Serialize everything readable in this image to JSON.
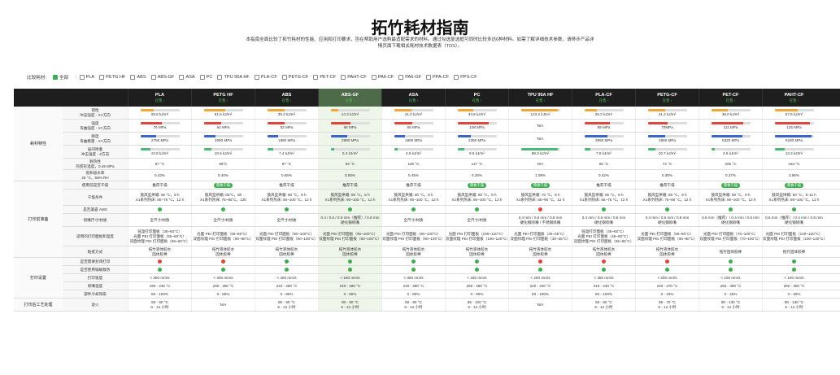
{
  "page": {
    "title": "拓竹耗材指南",
    "description": "本指南全面比较了拓竹耗材的性能、应用和打印要求，旨在帮助用户选购最适配需求的材料。通过勾选复选框可同时比较多达6种材料。如需了解详细技术参数，请移步产品详情页面下载相关耗材技术数据表（TDS）。"
  },
  "colors": {
    "accent": "#3fae4e",
    "header_bg": "#1e1e1e",
    "danger": "#e0463a",
    "highlight": "#eef6ea"
  },
  "filter": {
    "label": "比较耗材:",
    "options": [
      {
        "label": "全部",
        "checked": true
      },
      {
        "label": "PLA",
        "checked": false
      },
      {
        "label": "PETG HF",
        "checked": false
      },
      {
        "label": "ABS",
        "checked": false
      },
      {
        "label": "ABS-GF",
        "checked": false
      },
      {
        "label": "ASA",
        "checked": false
      },
      {
        "label": "PC",
        "checked": false
      },
      {
        "label": "TPU 95A HF",
        "checked": false
      },
      {
        "label": "PLA-CF",
        "checked": false
      },
      {
        "label": "PETG-CF",
        "checked": false
      },
      {
        "label": "PET-CF",
        "checked": false
      },
      {
        "label": "PAHT-CF",
        "checked": false
      },
      {
        "label": "PA6-CF",
        "checked": false
      },
      {
        "label": "PA6-GF",
        "checked": false
      },
      {
        "label": "PPA-CF",
        "checked": false
      },
      {
        "label": "PPS-CF",
        "checked": false
      }
    ]
  },
  "materials": [
    {
      "name": "PLA",
      "sub": "在售 ›"
    },
    {
      "name": "PETG HF",
      "sub": "在售 ›"
    },
    {
      "name": "ABS",
      "sub": "在售 ›"
    },
    {
      "name": "ABS-GF",
      "sub": "在售 ›"
    },
    {
      "name": "ASA",
      "sub": "在售 ›"
    },
    {
      "name": "PC",
      "sub": "在售 ›"
    },
    {
      "name": "TPU 95A HF",
      "sub": "在售 ›"
    },
    {
      "name": "PLA-CF",
      "sub": "在售 ›"
    },
    {
      "name": "PETG-CF",
      "sub": "在售 ›"
    },
    {
      "name": "PET-CF",
      "sub": "在售 ›"
    },
    {
      "name": "PAHT-CF",
      "sub": "在售 ›"
    }
  ],
  "groups": [
    {
      "label": "耗材特性",
      "rows": [
        {
          "attr": "韧性\n冲击强度 - XY方向",
          "h": 16,
          "type": "bar",
          "scheme": "orange",
          "values": [
            "28.6 kJ/m²",
            "51.5 kJ/m²",
            "39.3 kJ/m²",
            "14.3 kJ/m²",
            "41.0 kJ/m²",
            "34.8 kJ/m²",
            "123.2 kJ/m²",
            "25.2 kJ/m²",
            "41.2 kJ/m²",
            "36.0 kJ/m²",
            "57.5 kJ/m²"
          ],
          "levels": [
            0.35,
            0.55,
            0.45,
            0.2,
            0.45,
            0.4,
            0.95,
            0.32,
            0.45,
            0.42,
            0.6
          ]
        },
        {
          "attr": "强度\n弯曲强度 - XY方向",
          "h": 16,
          "type": "bar",
          "scheme": "red",
          "values": [
            "76 MPa",
            "64 MPa",
            "62 MPa",
            "68 MPa",
            "65 MPa",
            "108 MPa",
            "N/A",
            "89 MPa",
            "70MPa",
            "111 MPa",
            "125 MPa"
          ],
          "levels": [
            0.55,
            0.45,
            0.45,
            0.5,
            0.47,
            0.8,
            null,
            0.65,
            0.5,
            0.82,
            0.9
          ]
        },
        {
          "attr": "刚度\n弯曲模量 - XY方向",
          "h": 16,
          "type": "bar",
          "scheme": "blue",
          "values": [
            "2750 MPa",
            "2050 MPa",
            "1880 MPa",
            "2860 MPa",
            "1900 MPa",
            "2350 MPa",
            "N/A",
            "3950 MPa",
            "2950 MPa",
            "5320 MPa",
            "6230 MPa"
          ],
          "levels": [
            0.4,
            0.3,
            0.28,
            0.42,
            0.28,
            0.35,
            null,
            0.6,
            0.45,
            0.8,
            0.95
          ]
        },
        {
          "attr": "层间附着\n冲击强度 - Z方向",
          "h": 16,
          "type": "bar",
          "scheme": "green",
          "values": [
            "13.8 kJ/m²",
            "10.6 kJ/m²",
            "7.4 kJ/m²",
            "5.3 kJ/m²",
            "4.9 kJ/m²",
            "9.8 kJ/m²",
            "88.3 kJ/m²",
            "7.8 kJ/m²",
            "10.7 kJ/m²",
            "4.5 kJ/m²",
            "13.3 kJ/m²"
          ],
          "levels": [
            0.25,
            0.2,
            0.15,
            0.1,
            0.1,
            0.18,
            0.95,
            0.15,
            0.2,
            0.1,
            0.25
          ]
        },
        {
          "attr": "耐热性\n热变形温度，0.45 MPa",
          "h": 14,
          "type": "text",
          "values": [
            "57 °C",
            "69°C",
            "87 °C",
            "94 °C",
            "100 °C",
            "117 °C",
            "N/A",
            "55 °C",
            "74 °C",
            "205 °C",
            "194 °C"
          ]
        },
        {
          "attr": "饱和吸水率\n25 °C，55% RH",
          "h": 14,
          "type": "text",
          "values": [
            "0.43%",
            "0.40%",
            "0.65%",
            "0.55%",
            "0.45%",
            "0.25%",
            "1.08%",
            "0.42%",
            "0.30%",
            "0.37%",
            "3.86%"
          ]
        }
      ]
    },
    {
      "label": "打印前准备",
      "rows": [
        {
          "attr": "使用前是否干燥",
          "h": 10,
          "type": "mixed",
          "values": [
            {
              "t": "推荐干燥"
            },
            {
              "t": "需要干燥",
              "pill": true
            },
            {
              "t": "推荐干燥"
            },
            {
              "t": "推荐干燥"
            },
            {
              "t": "推荐干燥"
            },
            {
              "t": "需要干燥",
              "pill": true
            },
            {
              "t": "需要干燥",
              "pill": true
            },
            {
              "t": "推荐干燥"
            },
            {
              "t": "推荐干燥"
            },
            {
              "t": "需要干燥",
              "pill": true
            },
            {
              "t": "需要干燥",
              "pill": true
            }
          ]
        },
        {
          "attr": "干燥条件",
          "h": 20,
          "type": "text",
          "values": [
            "鼓风型烘箱: 55 °C，8 h\nX1系列热床: 65~75 °C，12 h",
            "鼓风型烘箱: 65°C，8h\nX1系列热床: 75~85°C，12h",
            "鼓风型烘箱: 80 °C，8 h\nX1系列热床: 90~100 °C，12 h",
            "鼓风型烘箱: 80 °C，8 h\nX1系列热床: 90~100 °C，12 h",
            "鼓风型烘箱: 80 °C，8 h\nX1系列热床: 90~100 °C，12 h",
            "鼓风型烘箱: 80 °C，8 h\nX1系列热床: 90~100 °C，12 h",
            "鼓风型烘箱: 70 °C，8 h\nX1系列热床: 80~90 °C，12 h",
            "鼓风型烘箱: 55 °C，8 h\nX1系列热床: 65~75 °C，12 h",
            "鼓风型烘箱: 65 °C，8 h\nX1系列热床: 75~85 °C，12 h",
            "鼓风型烘箱: 80 °C，8 h\nX1系列热床: 90~100 °C，12 h",
            "鼓风型烘箱: 80 °C，8-12 h\nX1系列热床: 90~100 °C，12 h"
          ]
        },
        {
          "attr": "是否兼容 AMS",
          "h": 10,
          "type": "dot",
          "values": [
            "ok",
            "ok",
            "ok",
            "ok",
            "ok",
            "ok",
            "no",
            "ok",
            "ok",
            "ok",
            "ok"
          ]
        },
        {
          "attr": "喷嘴尺寸/材质",
          "h": 16,
          "type": "text",
          "values": [
            "全尺寸/材质",
            "全尺寸/材质",
            "全尺寸/材质",
            "0.4 / 0.6 / 0.8 mm（推荐）/ 0.8 mm\n硬化钢喷嘴",
            "全尺寸/材质",
            "全尺寸/材质",
            "0.4 mm / 0.6 mm / 0.8 mm\n硬化钢喷嘴 / 不锈钢喷嘴",
            "0.4 mm / 0.6 mm / 0.8 mm\n硬化钢喷嘴",
            "0.4 mm / 0.6 mm / 0.8 mm\n硬化钢喷嘴",
            "0.6 mm（推荐）/ 0.4 mm / 0.8 mm\n硬化钢喷嘴",
            "0.6 mm（推荐）/ 0.4 mm / 0.8 mm\n硬化钢喷嘴"
          ]
        },
        {
          "attr": "适用的打印面板和温度",
          "h": 24,
          "type": "text",
          "values": [
            "低温打印面板（35~50°C）\n光面 PEI 打印面板（55~60°C）\n双面纹理 PEI 打印面板（55~60°C）",
            "光面 PEI 打印面板（60~80°C）\n双面纹理 PEI 打印面板（60~80°C）",
            "光面 PEI 打印面板（90~100°C）\n双面纹理 PEI 打印面板（90~100°C）",
            "光面 PEI 打印面板（90~100°C）\n双面纹理 PEI 打印面板（90~100°C）",
            "光面 PEI 打印面板（90~100°C）\n双面纹理 PEI 打印面板（90~100°C）",
            "光面 PEI 打印面板（100~120°C）\n双面纹理 PEI 打印面板（100~120°C）",
            "光面 PEI 打印面板（30~35°C）\n双面纹理 PEI 打印面板（30~35°C）",
            "低温打印面板（45~60°C）\n光面 PEI 打印面板（45~60°C）\n双面纹理 PEI 打印面板（55~65°C）",
            "光面 PEI 打印面板（60~80°C）\n双面纹理 PEI 打印面板（60~80°C）",
            "光面 PEI 打印面板（70~100°C）\n双面纹理 PEI 打印面板（70~100°C）",
            "光面 PEI 打印面板（100~120°C）\n双面纹理 PEI 打印面板（100~120°C）"
          ]
        },
        {
          "attr": "粘接方式",
          "h": 14,
          "type": "text",
          "values": [
            "拓竹液体胶水\n固体胶棒",
            "拓竹液体胶水\n固体胶棒",
            "拓竹液体胶水\n固体胶棒",
            "拓竹液体胶水\n固体胶棒",
            "拓竹液体胶水\n固体胶棒",
            "拓竹液体胶水\n固体胶棒",
            "拓竹液体胶水\n固体胶棒",
            "拓竹液体胶水\n固体胶棒",
            "拓竹液体胶水\n固体胶棒",
            "拓竹固体胶棒",
            "拓竹固体胶棒"
          ]
        }
      ]
    },
    {
      "label": "打印设置",
      "rows": [
        {
          "attr": "是否需要封闭打印",
          "h": 10,
          "type": "dot",
          "values": [
            "no",
            "no",
            "ok",
            "ok",
            "ok",
            "ok",
            "no",
            "no",
            "no",
            "ok",
            "ok"
          ]
        },
        {
          "attr": "是否使用辅助散热",
          "h": 10,
          "type": "dot",
          "values": [
            "ok",
            "ok",
            "ok",
            "ok",
            "ok",
            "ok",
            "ok",
            "ok",
            "ok",
            "ok",
            "ok"
          ]
        },
        {
          "attr": "打印速度",
          "h": 10,
          "type": "text",
          "values": [
            "< 300 mm/s",
            "< 300 mm/s",
            "< 300 mm/s",
            "< 180 mm/s",
            "< 300 mm/s",
            "< 330 mm/s",
            "< 200 mm/s",
            "< 250 mm/s",
            "< 200 mm/s",
            "< 100 mm/s",
            "< 100 mm/s"
          ]
        },
        {
          "attr": "喷嘴温度",
          "h": 10,
          "type": "text",
          "values": [
            "190 - 230 °C",
            "230 - 260 °C",
            "240 - 280 °C",
            "240 - 280 °C",
            "240 - 280 °C",
            "260 - 280 °C",
            "220 - 240 °C",
            "210 - 240 °C",
            "240 - 270 °C",
            "260 - 300 °C",
            "260 - 300 °C"
          ]
        },
        {
          "attr": "部件冷却风扇",
          "h": 10,
          "type": "text",
          "values": [
            "50 - 100%",
            "0 - 80%",
            "0 - 80%",
            "0 - 80%",
            "0 - 80%",
            "0 - 60%",
            "50 - 100%",
            "50 - 100%",
            "0 - 40%",
            "0 - 40%",
            "0 - 40%"
          ]
        }
      ]
    },
    {
      "label": "打印后工艺处理",
      "rows": [
        {
          "attr": "退火",
          "h": 16,
          "type": "text",
          "values": [
            "50 - 60 °C\n6 - 12 小时",
            "N/A",
            "80 - 90 °C\n6 - 12 小时",
            "80 - 90 °C\n6 - 12 小时",
            "80 - 90 °C\n6 - 12 小时",
            "85 - 100 °C\n6 - 12 小时",
            "N/A",
            "55 - 60 °C\n6 - 12 小时",
            "65 - 70 °C\n6 - 12 小时",
            "90 - 130 °C\n6 - 12 小时",
            "90 - 130 °C\n6 - 12 小时"
          ]
        }
      ]
    }
  ],
  "highlight_index": 3
}
